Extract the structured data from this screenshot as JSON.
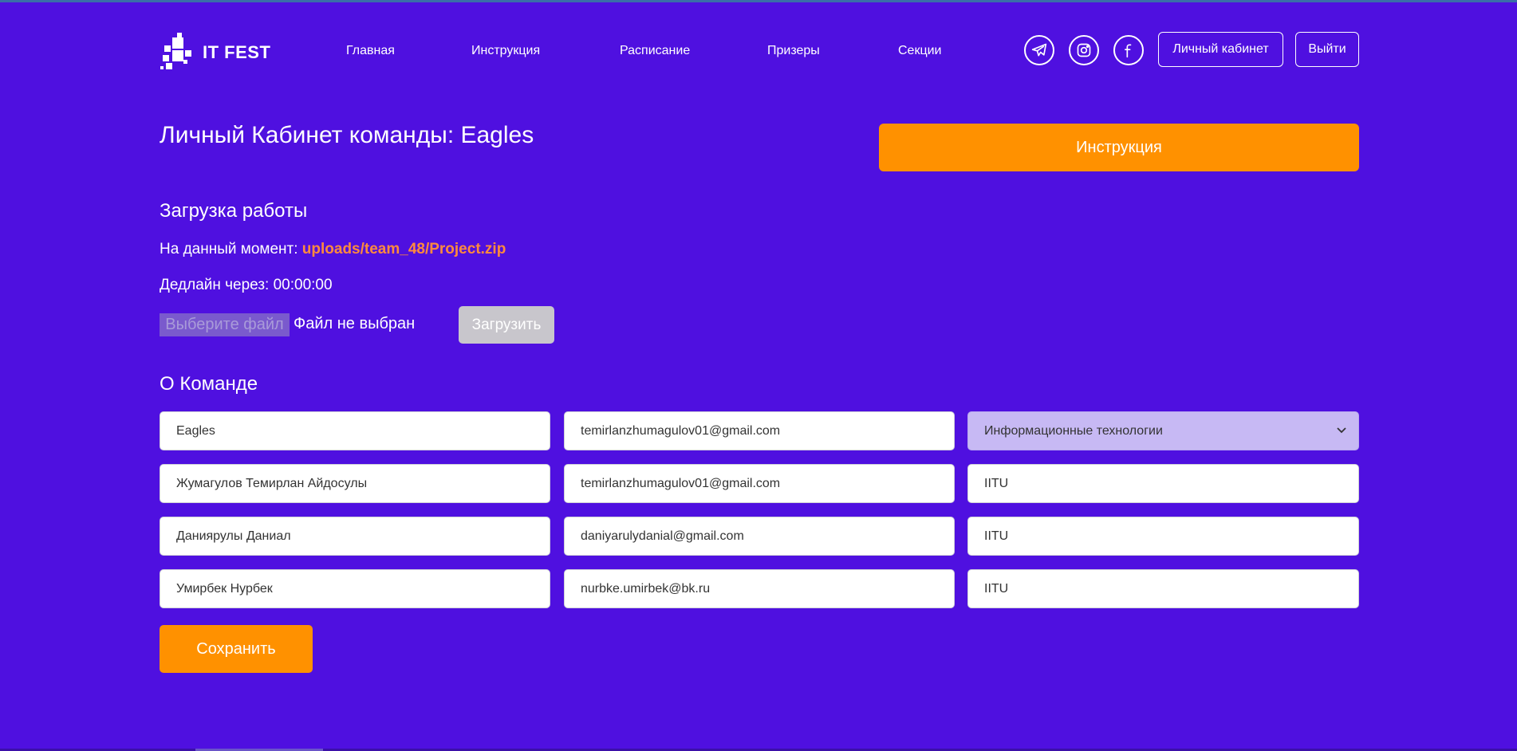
{
  "header": {
    "logo_text": "IT FEST",
    "nav": [
      "Главная",
      "Инструкция",
      "Расписание",
      "Призеры",
      "Секции"
    ],
    "social_icons": [
      "telegram-icon",
      "instagram-icon",
      "facebook-icon"
    ],
    "cabinet_label": "Личный кабинет",
    "logout_label": "Выйти"
  },
  "page": {
    "title": "Личный Кабинет команды: Eagles",
    "instruction_button": "Инструкция"
  },
  "upload": {
    "section_title": "Загрузка работы",
    "current_label": "На данный момент:",
    "current_file": "uploads/team_48/Project.zip",
    "deadline_label": "Дедлайн через:",
    "deadline_value": "00:00:00",
    "choose_file_label": "Выберите файл",
    "no_file_label": "Файл не выбран",
    "upload_button": "Загрузить"
  },
  "team": {
    "section_title": "О Команде",
    "team_name": "Eagles",
    "team_email": "temirlanzhumagulov01@gmail.com",
    "section_selected": "Информационные технологии",
    "members": [
      {
        "name": "Жумагулов Темирлан Айдосулы",
        "email": "temirlanzhumagulov01@gmail.com",
        "university": "IITU"
      },
      {
        "name": "Даниярулы Даниал",
        "email": "daniyarulydanial@gmail.com",
        "university": "IITU"
      },
      {
        "name": "Умирбек Нурбек",
        "email": "nurbke.umirbek@bk.ru",
        "university": "IITU"
      }
    ],
    "save_button": "Сохранить"
  },
  "colors": {
    "background": "#4f10e0",
    "accent": "#ff9100",
    "link": "#ff8a3d",
    "select_bg": "#c7b9f4"
  }
}
